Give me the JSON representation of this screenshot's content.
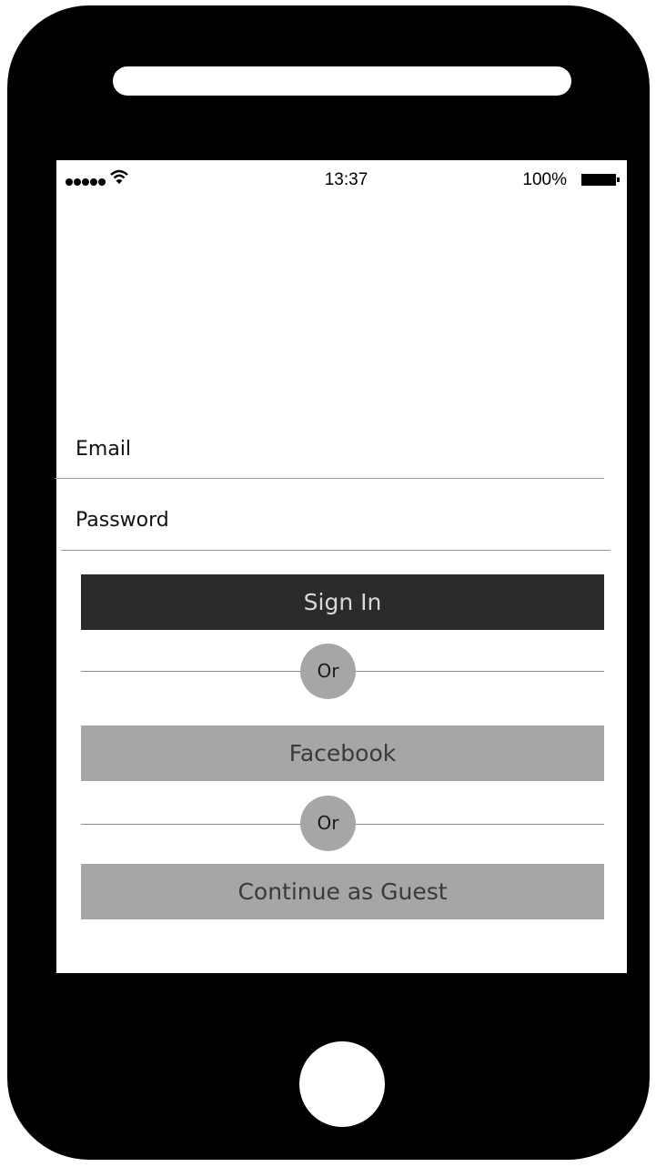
{
  "status_bar": {
    "time": "13:37",
    "battery_percent": "100%",
    "signal_icon": "signal-dots-icon",
    "wifi_icon": "wifi-icon",
    "battery_icon": "battery-icon"
  },
  "login_form": {
    "email_placeholder": "Email",
    "password_placeholder": "Password"
  },
  "buttons": {
    "sign_in": "Sign In",
    "facebook": "Facebook",
    "guest": "Continue as Guest"
  },
  "dividers": {
    "first": "Or",
    "second": "Or"
  },
  "colors": {
    "device_body": "#000000",
    "primary_button": "#2b2b2b",
    "secondary_button": "#a6a6a6"
  }
}
